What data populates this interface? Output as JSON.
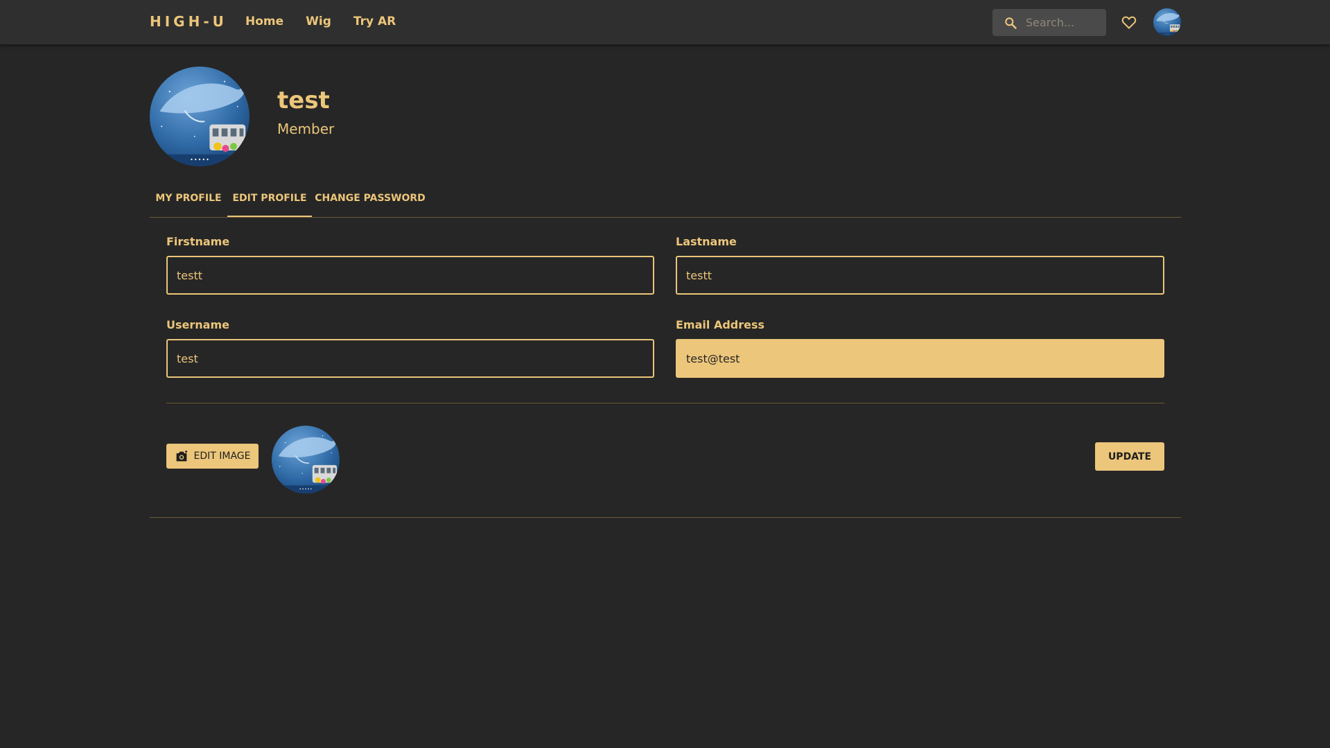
{
  "navbar": {
    "brand": "HIGH-U",
    "links": [
      "Home",
      "Wig",
      "Try AR"
    ],
    "search_placeholder": "Search...",
    "favorites_icon": "heart-icon",
    "avatar_icon": "user-avatar-whale"
  },
  "profile": {
    "name": "test",
    "role": "Member",
    "avatar_icon": "user-avatar-whale"
  },
  "tabs": [
    "MY PROFILE",
    "EDIT PROFILE",
    "CHANGE PASSWORD"
  ],
  "active_tab": "EDIT PROFILE",
  "form": {
    "firstname": {
      "label": "Firstname",
      "value": "testt"
    },
    "lastname": {
      "label": "Lastname",
      "value": "testt"
    },
    "username": {
      "label": "Username",
      "value": "test"
    },
    "email": {
      "label": "Email Address",
      "value": "test@test"
    }
  },
  "actions": {
    "edit_image_label": "EDIT IMAGE",
    "edit_image_icon": "camera-icon",
    "update_label": "UPDATE"
  },
  "colors": {
    "background": "#262626",
    "navbar": "#2f2f2f",
    "accent": "#ecc67a",
    "divider": "#6b5a35"
  }
}
